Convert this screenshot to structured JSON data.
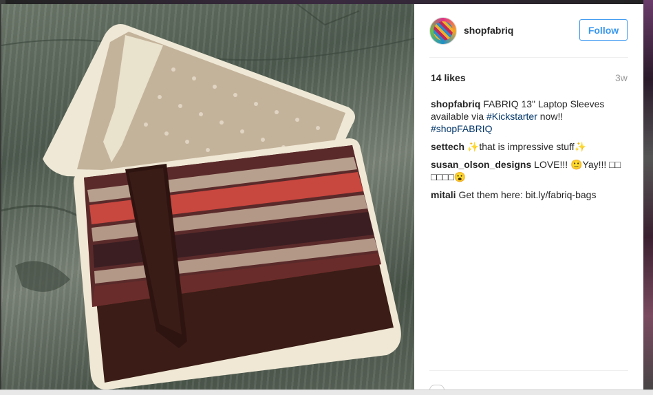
{
  "post": {
    "username": "shopfabriq",
    "follow_label": "Follow",
    "likes": "14 likes",
    "age": "3w",
    "caption": {
      "user": "shopfabriq",
      "text_a": "FABRIQ 13\" Laptop Sleeves available via",
      "hashtag1": "#Kickstarter",
      "text_b": "now!!",
      "hashtag2": "#shopFABRIQ"
    },
    "comments": [
      {
        "user": "settech",
        "text": "✨that is impressive stuff✨"
      },
      {
        "user": "susan_olson_designs",
        "text": "LOVE!!! 🙂Yay!!! □□ □□□□😮"
      },
      {
        "user": "mitali",
        "text": "Get them here: bit.ly/fabriq-bags"
      }
    ]
  },
  "photo": {
    "subject": "laptop sleeves on wooden table",
    "colors": {
      "wood": "#5a6658",
      "back_sleeve": "#c9b9a3",
      "leather": "#3a1a14",
      "stripe_red": "#c8473f"
    }
  }
}
